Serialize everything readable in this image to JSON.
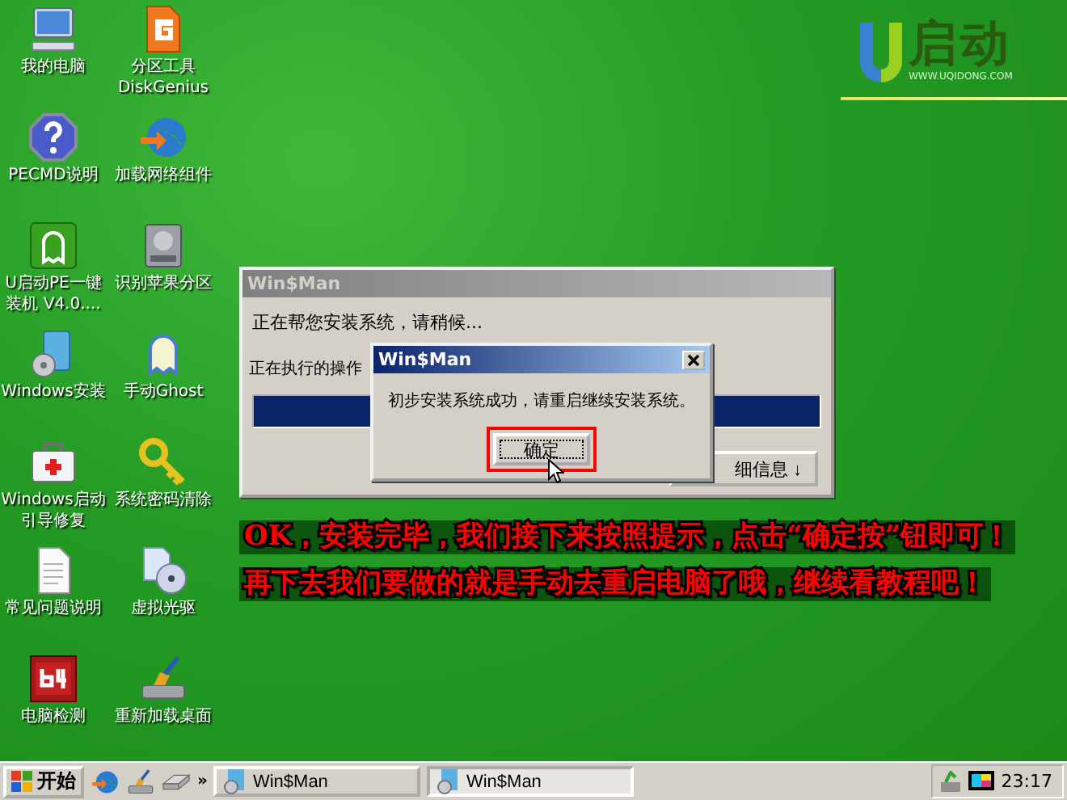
{
  "desktop_icons": [
    {
      "kind": "computer",
      "lines": [
        "我的电脑"
      ]
    },
    {
      "kind": "partition",
      "lines": [
        "分区工具",
        "DiskGenius"
      ]
    },
    {
      "kind": "help",
      "lines": [
        "PECMD说明"
      ]
    },
    {
      "kind": "network",
      "lines": [
        "加载网络组件"
      ]
    },
    {
      "kind": "ghost-app",
      "lines": [
        "U启动PE一键",
        "装机 V4.0...."
      ]
    },
    {
      "kind": "disk",
      "lines": [
        "识别苹果分区"
      ]
    },
    {
      "kind": "installer",
      "lines": [
        "Windows安装"
      ]
    },
    {
      "kind": "ghost",
      "lines": [
        "手动Ghost"
      ]
    },
    {
      "kind": "medkit",
      "lines": [
        "Windows启动",
        "引导修复"
      ]
    },
    {
      "kind": "key",
      "lines": [
        "系统密码清除"
      ]
    },
    {
      "kind": "document",
      "lines": [
        "常见问题说明"
      ]
    },
    {
      "kind": "cd",
      "lines": [
        "虚拟光驱"
      ]
    },
    {
      "kind": "benchmark",
      "lines": [
        "电脑检测"
      ]
    },
    {
      "kind": "broom",
      "lines": [
        "重新加载桌面"
      ]
    }
  ],
  "logo": {
    "name": "启动",
    "url": "WWW.UQIDONG.COM"
  },
  "back_dialog": {
    "title": "Win$Man",
    "message": "正在帮您安装系统，请稍候...",
    "operation_label": "正在执行的操作",
    "progress": {
      "level": 1
    },
    "button": "细信息 ↓"
  },
  "front_dialog": {
    "title": "Win$Man",
    "message": "初步安装系统成功，请重启继续安装系统。",
    "button": "确定",
    "button_highlighted": true
  },
  "annotation": [
    "OK，安装完毕，我们接下来按照提示，点击“确定按”钮即可！",
    "再下去我们要做的就是手动去重启电脑了哦，继续看教程吧！"
  ],
  "taskbar": {
    "start": "开始",
    "quick_launch": [
      {
        "kind": "network"
      },
      {
        "kind": "broom"
      },
      {
        "kind": "drive"
      }
    ],
    "overflow": "»",
    "tasks": [
      {
        "label": "Win$Man",
        "selected": false
      },
      {
        "label": "Win$Man",
        "selected": true
      }
    ],
    "clock": "23:17"
  }
}
